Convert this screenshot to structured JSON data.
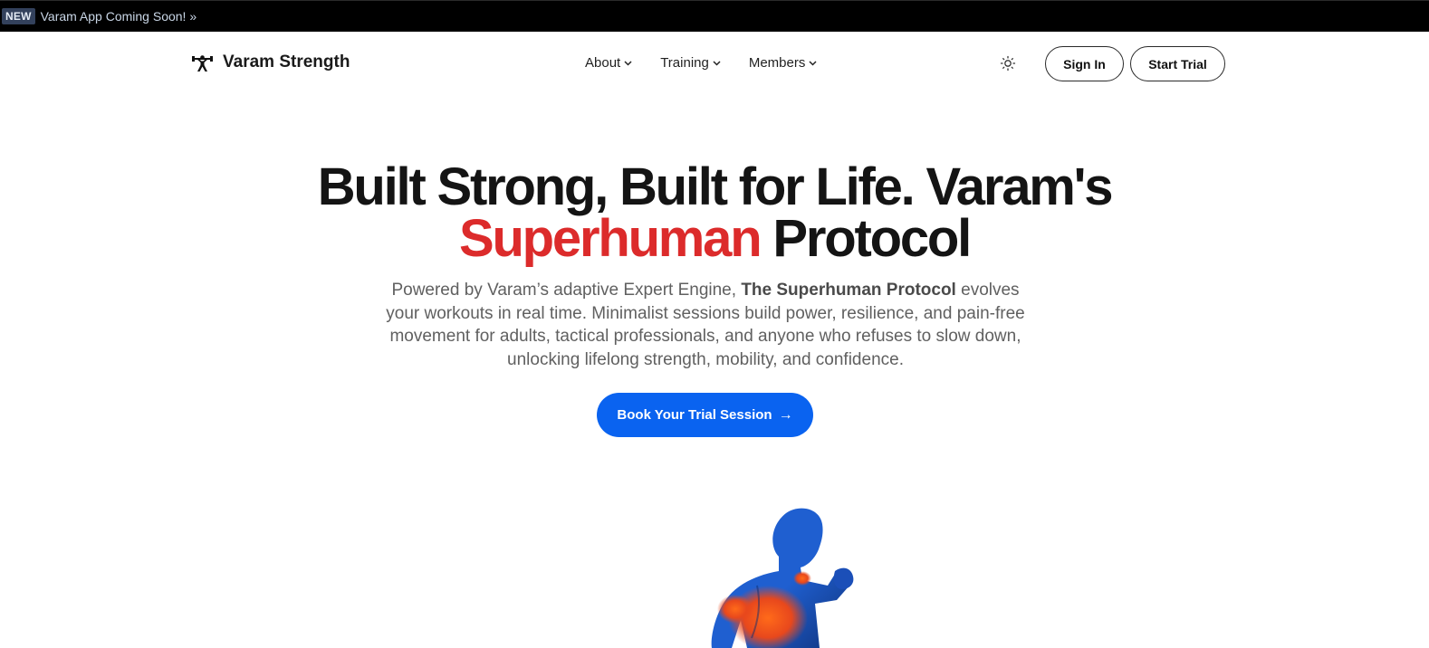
{
  "announcement": {
    "badge": "NEW",
    "message": "Varam App Coming Soon! »"
  },
  "brand": {
    "name": "Varam Strength",
    "logo_icon": "weightlifter-icon"
  },
  "nav": {
    "items": [
      {
        "label": "About",
        "icon": "chevron-down-icon"
      },
      {
        "label": "Training",
        "icon": "chevron-down-icon"
      },
      {
        "label": "Members",
        "icon": "chevron-down-icon"
      }
    ],
    "theme_toggle_icon": "sun-icon",
    "sign_in_label": "Sign In",
    "start_trial_label": "Start Trial"
  },
  "hero": {
    "title_line1": "Built Strong, Built for Life. Varam's",
    "title_accent": "Superhuman",
    "title_rest": "Protocol",
    "subtitle_intro": "Powered by Varam’s adaptive Expert Engine,",
    "subtitle_emphasis": "The Superhuman Protocol",
    "subtitle_rest": "evolves your workouts in real time. Minimalist sessions build power, resilience, and pain-free movement for adults, tactical professionals, and anyone who refuses to slow down, unlocking lifelong strength, mobility, and confidence.",
    "cta_label": "Book Your Trial Session",
    "cta_icon": "arrow-right-icon"
  },
  "colors": {
    "announcement_bg": "#000000",
    "accent_red": "#dc2b2b",
    "cta_blue": "#0a63f0",
    "figure_blue": "#1f5fd0",
    "figure_orange": "#f0541e"
  }
}
